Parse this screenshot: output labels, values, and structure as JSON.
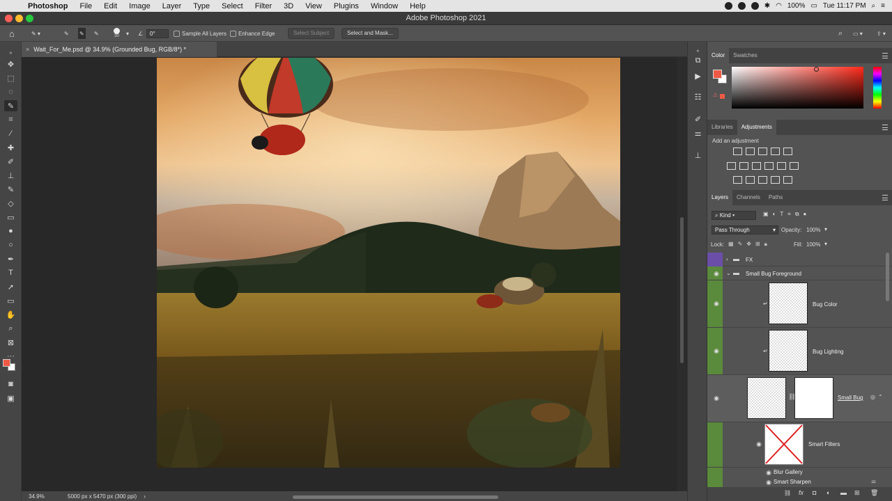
{
  "menubar": {
    "app": "Photoshop",
    "items": [
      "File",
      "Edit",
      "Image",
      "Layer",
      "Type",
      "Select",
      "Filter",
      "3D",
      "View",
      "Plugins",
      "Window",
      "Help"
    ],
    "battery": "100%",
    "clock": "Tue 11:17 PM"
  },
  "window": {
    "title": "Adobe Photoshop 2021"
  },
  "options": {
    "brush_size": "30",
    "angle": "0°",
    "sample_all_layers": "Sample All Layers",
    "enhance_edge": "Enhance Edge",
    "select_subject": "Select Subject",
    "select_and_mask": "Select and Mask..."
  },
  "document": {
    "tab_label": "Wait_For_Me.psd @ 34.9% (Grounded Bug, RGB/8*) *",
    "zoom": "34.9%",
    "dimensions": "5000 px x 5470 px (300 ppi)"
  },
  "color_panel": {
    "tabs": [
      "Color",
      "Swatches"
    ],
    "foreground": "#ee5a46",
    "background": "#ffffff"
  },
  "adjustments_panel": {
    "tabs": [
      "Libraries",
      "Adjustments"
    ],
    "hint": "Add an adjustment"
  },
  "layers_panel": {
    "tabs": [
      "Layers",
      "Channels",
      "Paths"
    ],
    "filter_kind": "Kind",
    "blend_mode": "Pass Through",
    "opacity_label": "Opacity:",
    "opacity": "100%",
    "lock_label": "Lock:",
    "fill_label": "Fill:",
    "fill": "100%",
    "layers": {
      "fx": "FX",
      "group": "Small Bug Foreground",
      "bug_color": "Bug Color",
      "bug_lighting": "Bug Lighting",
      "small_bug": "Small Bug",
      "smart_filters": "Smart Filters",
      "blur_gallery": "Blur Gallery",
      "smart_sharpen": "Smart Sharpen"
    }
  }
}
